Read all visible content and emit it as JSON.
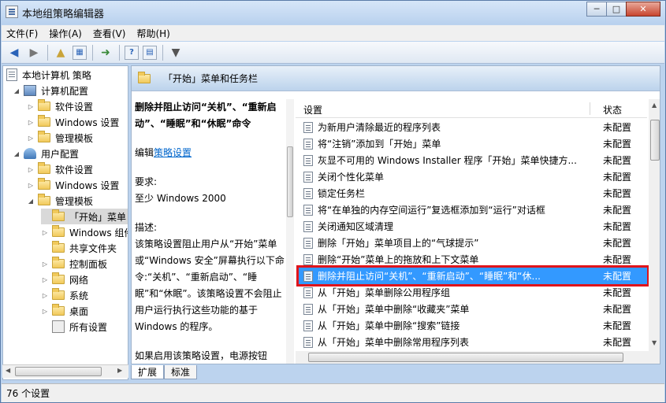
{
  "window": {
    "title": "本地组策略编辑器"
  },
  "menu": [
    "文件(F)",
    "操作(A)",
    "查看(V)",
    "帮助(H)"
  ],
  "tree": {
    "root": "本地计算机 策略",
    "computer": "计算机配置",
    "computer_children": [
      "软件设置",
      "Windows 设置",
      "管理模板"
    ],
    "user": "用户配置",
    "user_children": [
      "软件设置",
      "Windows 设置",
      "管理模板"
    ],
    "admin_children": [
      "「开始」菜单",
      "Windows 组件",
      "共享文件夹",
      "控制面板",
      "网络",
      "系统",
      "桌面",
      "所有设置"
    ]
  },
  "header": {
    "title": "「开始」菜单和任务栏"
  },
  "description": {
    "title": "删除并阻止访问“关机”、“重新启动”、“睡眠”和“休眠”命令",
    "edit_prefix": "编辑",
    "edit_link": "策略设置",
    "requirement_label": "要求:",
    "requirement_value": "至少 Windows 2000",
    "desc_label": "描述:",
    "desc_text": "该策略设置阻止用户从“开始”菜单或“Windows 安全”屏幕执行以下命令:“关机”、“重新启动”、“睡眠”和“休眠”。该策略设置不会阻止用户运行执行这些功能的基于 Windows 的程序。",
    "desc_text2": "如果启用该策略设置，电源按钮和“关机”、“重新启动”、“睡"
  },
  "list": {
    "col_setting": "设置",
    "col_state": "状态",
    "rows": [
      {
        "name": "为新用户清除最近的程序列表",
        "state": "未配置"
      },
      {
        "name": "将“注销”添加到「开始」菜单",
        "state": "未配置"
      },
      {
        "name": "灰显不可用的 Windows Installer 程序「开始」菜单快捷方...",
        "state": "未配置"
      },
      {
        "name": "关闭个性化菜单",
        "state": "未配置"
      },
      {
        "name": "锁定任务栏",
        "state": "未配置"
      },
      {
        "name": "将“在单独的内存空间运行”复选框添加到“运行”对话框",
        "state": "未配置"
      },
      {
        "name": "关闭通知区域清理",
        "state": "未配置"
      },
      {
        "name": "删除「开始」菜单项目上的“气球提示”",
        "state": "未配置"
      },
      {
        "name": "删除“开始”菜单上的拖放和上下文菜单",
        "state": "未配置"
      },
      {
        "name": "删除并阻止访问“关机”、“重新启动”、“睡眠”和“休...",
        "state": "未配置"
      },
      {
        "name": "从「开始」菜单删除公用程序组",
        "state": "未配置"
      },
      {
        "name": "从「开始」菜单中删除“收藏夹”菜单",
        "state": "未配置"
      },
      {
        "name": "从「开始」菜单中删除“搜索”链接",
        "state": "未配置"
      },
      {
        "name": "从「开始」菜单中删除常用程序列表",
        "state": "未配置"
      }
    ],
    "selected_index": 9
  },
  "tabs": [
    "扩展",
    "标准"
  ],
  "status": "76 个设置"
}
